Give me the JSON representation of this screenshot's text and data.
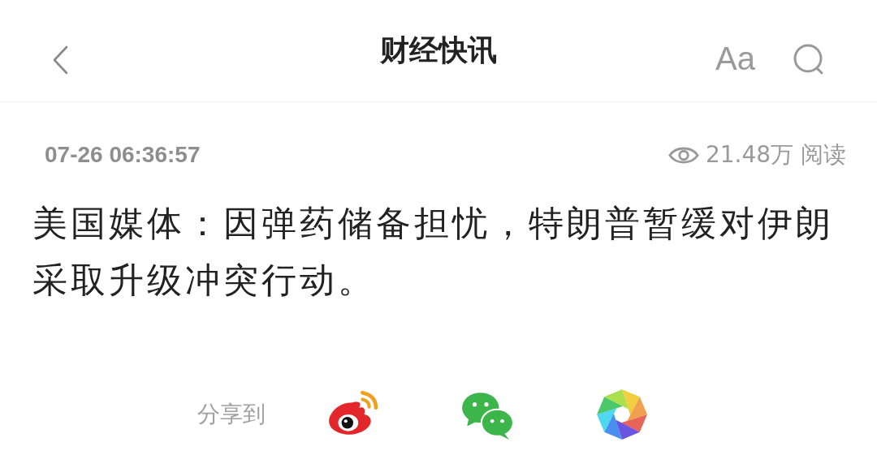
{
  "header": {
    "title": "财经快讯",
    "font_button": "Aa"
  },
  "article": {
    "time": "07-26 06:36:57",
    "views": "21.48万 阅读",
    "body": "美国媒体：因弹药储备担忧，特朗普暂缓对伊朗采取升级冲突行动。"
  },
  "share": {
    "label": "分享到",
    "targets": [
      {
        "kind": "weibo"
      },
      {
        "kind": "wechat"
      },
      {
        "kind": "moments"
      }
    ]
  }
}
